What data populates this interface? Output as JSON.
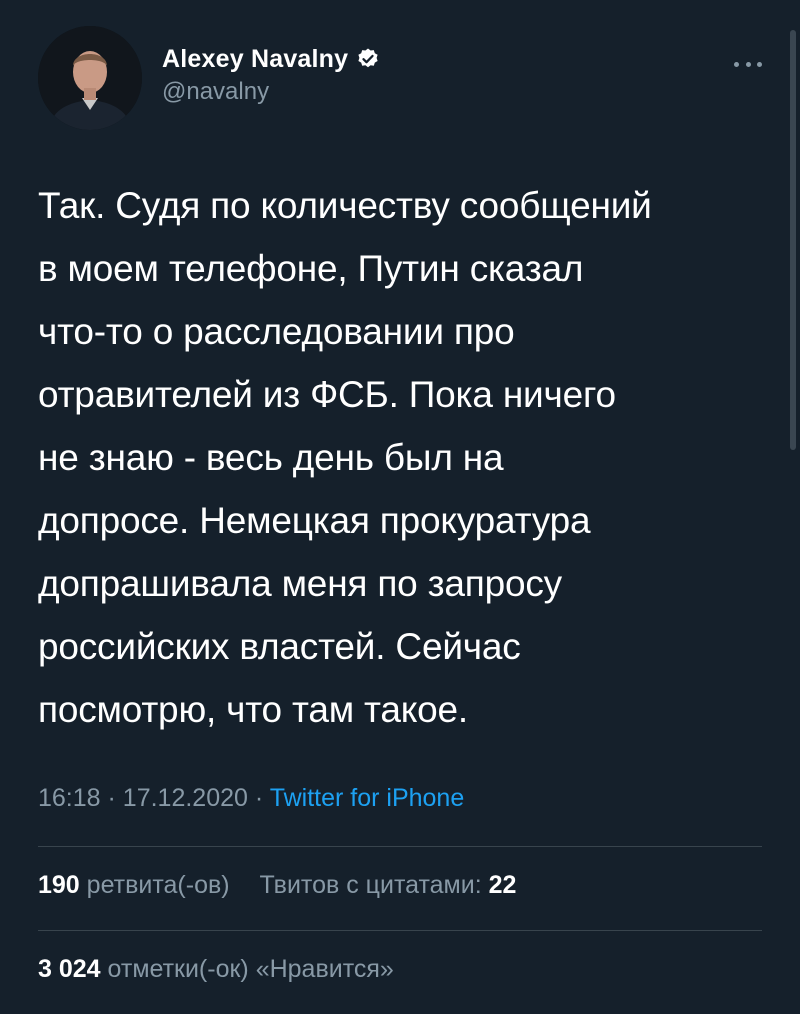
{
  "tweet": {
    "author": {
      "display_name": "Alexey Navalny",
      "handle": "@navalny",
      "verified": true
    },
    "text_lines": [
      "Так. Судя по количеству сообщений",
      "в моем телефоне, Путин сказал",
      "что-то о расследовании про",
      "отравителей из ФСБ. Пока ничего",
      "не знаю - весь день был на",
      "допросе. Немецкая прокуратура",
      "допрашивала меня по запросу",
      "российских властей. Сейчас",
      "посмотрю, что там такое."
    ],
    "time": "16:18",
    "date": "17.12.2020",
    "separator": "·",
    "source": "Twitter for iPhone",
    "stats": {
      "retweets_count": "190",
      "retweets_label": "ретвита(-ов)",
      "quotes_label": "Твитов с цитатами:",
      "quotes_count": "22",
      "likes_count": "3 024",
      "likes_label": "отметки(-ок) «Нравится»"
    }
  },
  "icons": {
    "verified": "verified-badge-icon",
    "more": "more-options-icon"
  },
  "colors": {
    "background": "#15202b",
    "text": "#ffffff",
    "secondary": "#8899a6",
    "link": "#1da1f2",
    "divider": "#38444d"
  }
}
